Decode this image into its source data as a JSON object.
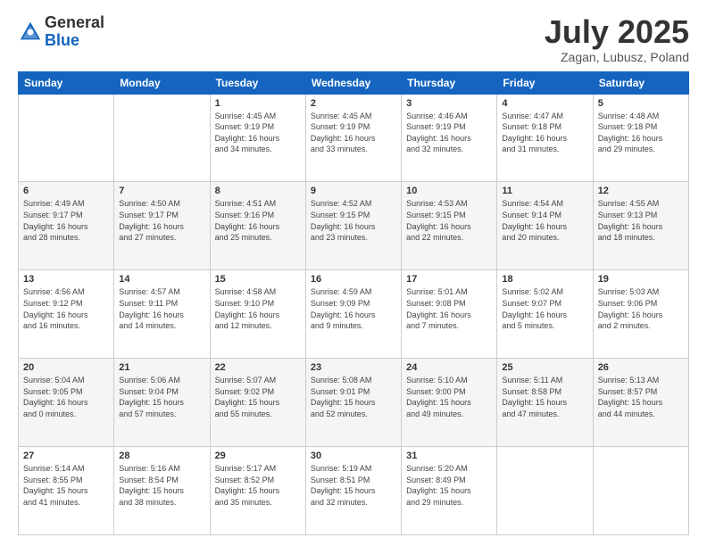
{
  "header": {
    "logo_general": "General",
    "logo_blue": "Blue",
    "month_title": "July 2025",
    "subtitle": "Zagan, Lubusz, Poland"
  },
  "days_of_week": [
    "Sunday",
    "Monday",
    "Tuesday",
    "Wednesday",
    "Thursday",
    "Friday",
    "Saturday"
  ],
  "weeks": [
    [
      {
        "day": "",
        "info": ""
      },
      {
        "day": "",
        "info": ""
      },
      {
        "day": "1",
        "info": "Sunrise: 4:45 AM\nSunset: 9:19 PM\nDaylight: 16 hours\nand 34 minutes."
      },
      {
        "day": "2",
        "info": "Sunrise: 4:45 AM\nSunset: 9:19 PM\nDaylight: 16 hours\nand 33 minutes."
      },
      {
        "day": "3",
        "info": "Sunrise: 4:46 AM\nSunset: 9:19 PM\nDaylight: 16 hours\nand 32 minutes."
      },
      {
        "day": "4",
        "info": "Sunrise: 4:47 AM\nSunset: 9:18 PM\nDaylight: 16 hours\nand 31 minutes."
      },
      {
        "day": "5",
        "info": "Sunrise: 4:48 AM\nSunset: 9:18 PM\nDaylight: 16 hours\nand 29 minutes."
      }
    ],
    [
      {
        "day": "6",
        "info": "Sunrise: 4:49 AM\nSunset: 9:17 PM\nDaylight: 16 hours\nand 28 minutes."
      },
      {
        "day": "7",
        "info": "Sunrise: 4:50 AM\nSunset: 9:17 PM\nDaylight: 16 hours\nand 27 minutes."
      },
      {
        "day": "8",
        "info": "Sunrise: 4:51 AM\nSunset: 9:16 PM\nDaylight: 16 hours\nand 25 minutes."
      },
      {
        "day": "9",
        "info": "Sunrise: 4:52 AM\nSunset: 9:15 PM\nDaylight: 16 hours\nand 23 minutes."
      },
      {
        "day": "10",
        "info": "Sunrise: 4:53 AM\nSunset: 9:15 PM\nDaylight: 16 hours\nand 22 minutes."
      },
      {
        "day": "11",
        "info": "Sunrise: 4:54 AM\nSunset: 9:14 PM\nDaylight: 16 hours\nand 20 minutes."
      },
      {
        "day": "12",
        "info": "Sunrise: 4:55 AM\nSunset: 9:13 PM\nDaylight: 16 hours\nand 18 minutes."
      }
    ],
    [
      {
        "day": "13",
        "info": "Sunrise: 4:56 AM\nSunset: 9:12 PM\nDaylight: 16 hours\nand 16 minutes."
      },
      {
        "day": "14",
        "info": "Sunrise: 4:57 AM\nSunset: 9:11 PM\nDaylight: 16 hours\nand 14 minutes."
      },
      {
        "day": "15",
        "info": "Sunrise: 4:58 AM\nSunset: 9:10 PM\nDaylight: 16 hours\nand 12 minutes."
      },
      {
        "day": "16",
        "info": "Sunrise: 4:59 AM\nSunset: 9:09 PM\nDaylight: 16 hours\nand 9 minutes."
      },
      {
        "day": "17",
        "info": "Sunrise: 5:01 AM\nSunset: 9:08 PM\nDaylight: 16 hours\nand 7 minutes."
      },
      {
        "day": "18",
        "info": "Sunrise: 5:02 AM\nSunset: 9:07 PM\nDaylight: 16 hours\nand 5 minutes."
      },
      {
        "day": "19",
        "info": "Sunrise: 5:03 AM\nSunset: 9:06 PM\nDaylight: 16 hours\nand 2 minutes."
      }
    ],
    [
      {
        "day": "20",
        "info": "Sunrise: 5:04 AM\nSunset: 9:05 PM\nDaylight: 16 hours\nand 0 minutes."
      },
      {
        "day": "21",
        "info": "Sunrise: 5:06 AM\nSunset: 9:04 PM\nDaylight: 15 hours\nand 57 minutes."
      },
      {
        "day": "22",
        "info": "Sunrise: 5:07 AM\nSunset: 9:02 PM\nDaylight: 15 hours\nand 55 minutes."
      },
      {
        "day": "23",
        "info": "Sunrise: 5:08 AM\nSunset: 9:01 PM\nDaylight: 15 hours\nand 52 minutes."
      },
      {
        "day": "24",
        "info": "Sunrise: 5:10 AM\nSunset: 9:00 PM\nDaylight: 15 hours\nand 49 minutes."
      },
      {
        "day": "25",
        "info": "Sunrise: 5:11 AM\nSunset: 8:58 PM\nDaylight: 15 hours\nand 47 minutes."
      },
      {
        "day": "26",
        "info": "Sunrise: 5:13 AM\nSunset: 8:57 PM\nDaylight: 15 hours\nand 44 minutes."
      }
    ],
    [
      {
        "day": "27",
        "info": "Sunrise: 5:14 AM\nSunset: 8:55 PM\nDaylight: 15 hours\nand 41 minutes."
      },
      {
        "day": "28",
        "info": "Sunrise: 5:16 AM\nSunset: 8:54 PM\nDaylight: 15 hours\nand 38 minutes."
      },
      {
        "day": "29",
        "info": "Sunrise: 5:17 AM\nSunset: 8:52 PM\nDaylight: 15 hours\nand 35 minutes."
      },
      {
        "day": "30",
        "info": "Sunrise: 5:19 AM\nSunset: 8:51 PM\nDaylight: 15 hours\nand 32 minutes."
      },
      {
        "day": "31",
        "info": "Sunrise: 5:20 AM\nSunset: 8:49 PM\nDaylight: 15 hours\nand 29 minutes."
      },
      {
        "day": "",
        "info": ""
      },
      {
        "day": "",
        "info": ""
      }
    ]
  ]
}
